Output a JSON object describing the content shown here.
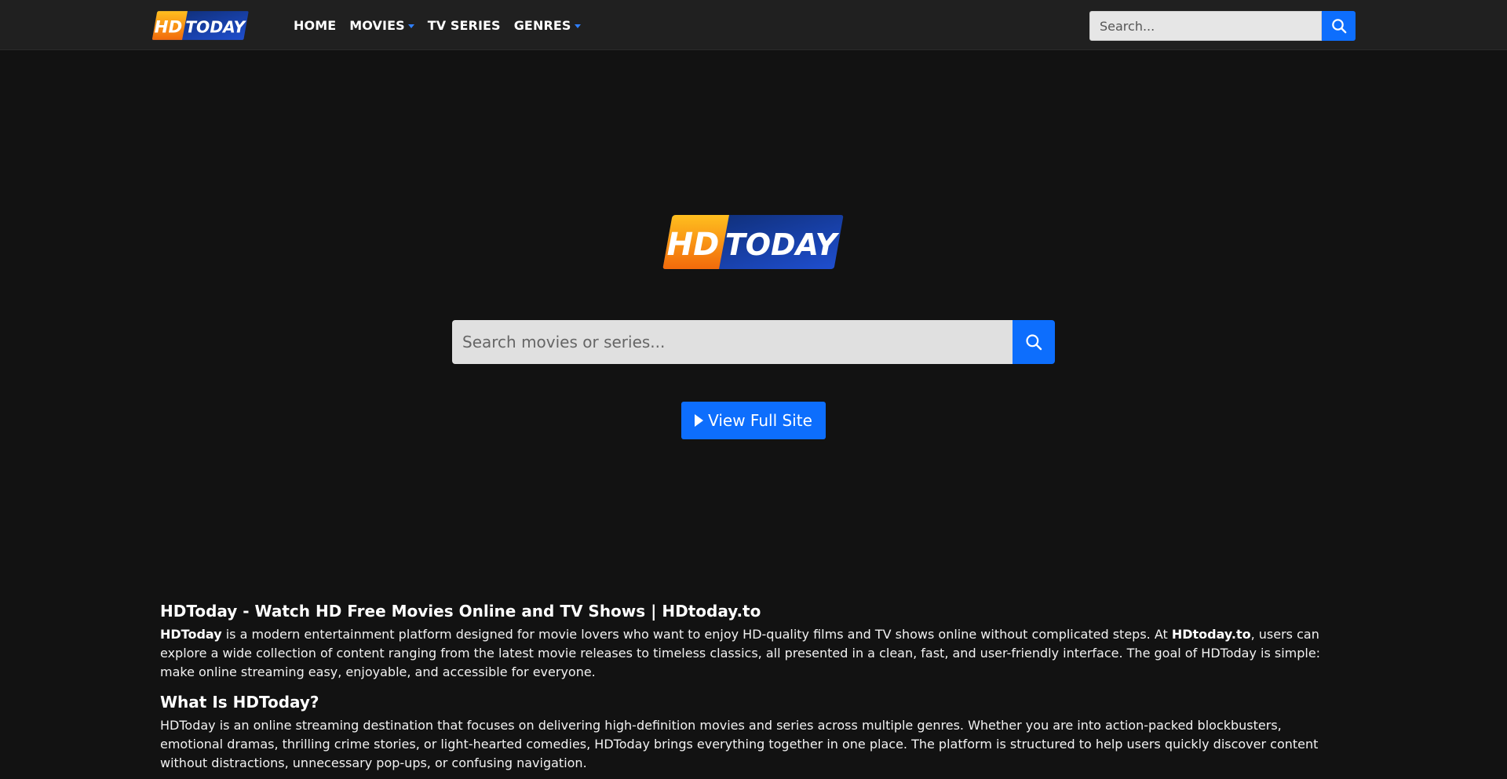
{
  "brand": {
    "logo_left": "HD",
    "logo_right": "TODAY"
  },
  "nav": [
    {
      "label": "HOME",
      "dropdown": false
    },
    {
      "label": "MOVIES",
      "dropdown": true
    },
    {
      "label": "TV SERIES",
      "dropdown": false
    },
    {
      "label": "GENRES",
      "dropdown": true
    }
  ],
  "header_search": {
    "placeholder": "Search...",
    "icon": "search-icon"
  },
  "hero": {
    "search_placeholder": "Search movies or series...",
    "search_icon": "search-icon",
    "view_button": "View Full Site",
    "view_button_icon": "play-icon"
  },
  "article": {
    "title": "HDToday - Watch HD Free Movies Online and TV Shows | HDtoday.to",
    "intro": {
      "strong1": "HDToday",
      "text1": " is a modern entertainment platform designed for movie lovers who want to enjoy HD-quality films and TV shows online without complicated steps. At ",
      "strong2": "HDtoday.to",
      "text2": ", users can explore a wide collection of content ranging from the latest movie releases to timeless classics, all presented in a clean, fast, and user-friendly interface. The goal of HDToday is simple: make online streaming easy, enjoyable, and accessible for everyone."
    },
    "section_title": "What Is HDToday?",
    "section_text": "HDToday is an online streaming destination that focuses on delivering high-definition movies and series across multiple genres. Whether you are into action-packed blockbusters, emotional dramas, thrilling crime stories, or light-hearted comedies, HDToday brings everything together in one place. The platform is structured to help users quickly discover content without distractions, unnecessary pop-ups, or confusing navigation."
  },
  "colors": {
    "accent": "#0d6efd",
    "background": "#121212",
    "navbar": "#202020",
    "logo_orange": "#f7931e",
    "logo_blue": "#1a3fa0"
  }
}
